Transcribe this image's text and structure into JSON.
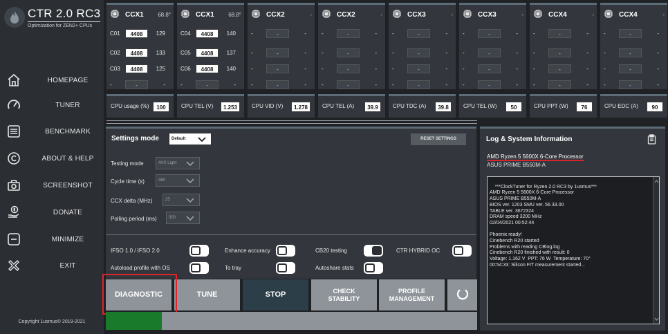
{
  "app": {
    "title": "CTR 2.0 RC3",
    "subtitle": "Optimization for ZEN2+ CPUs",
    "copyright": "Copyright 1usmus© 2019-2021"
  },
  "nav": [
    {
      "label": "HOMEPAGE",
      "icon": "home-icon"
    },
    {
      "label": "TUNER",
      "icon": "gauge-icon"
    },
    {
      "label": "BENCHMARK",
      "icon": "list-icon"
    },
    {
      "label": "ABOUT & HELP",
      "icon": "copyright-icon"
    },
    {
      "label": "SCREENSHOT",
      "icon": "camera-icon"
    },
    {
      "label": "DONATE",
      "icon": "donate-icon"
    },
    {
      "label": "MINIMIZE",
      "icon": "minimize-icon"
    },
    {
      "label": "EXIT",
      "icon": "exit-icon"
    }
  ],
  "ccx": [
    {
      "name": "CCX1",
      "temp": "68.8°",
      "cores": [
        {
          "id": "C01",
          "freq": "4408",
          "val": "129"
        },
        {
          "id": "C02",
          "freq": "4408",
          "val": "133"
        },
        {
          "id": "C03",
          "freq": "4408",
          "val": "125"
        },
        {
          "id": "-",
          "freq": "-",
          "val": "-"
        }
      ]
    },
    {
      "name": "CCX1",
      "temp": "68.8°",
      "cores": [
        {
          "id": "C04",
          "freq": "4408",
          "val": "140"
        },
        {
          "id": "C05",
          "freq": "4408",
          "val": "137"
        },
        {
          "id": "C06",
          "freq": "4408",
          "val": "140"
        },
        {
          "id": "-",
          "freq": "-",
          "val": "-"
        }
      ]
    },
    {
      "name": "CCX2",
      "temp": "-",
      "cores": [
        {
          "id": "-",
          "freq": "-",
          "val": "-"
        },
        {
          "id": "-",
          "freq": "-",
          "val": "-"
        },
        {
          "id": "-",
          "freq": "-",
          "val": "-"
        },
        {
          "id": "-",
          "freq": "-",
          "val": "-"
        }
      ]
    },
    {
      "name": "CCX2",
      "temp": "-",
      "cores": [
        {
          "id": "-",
          "freq": "-",
          "val": "-"
        },
        {
          "id": "-",
          "freq": "-",
          "val": "-"
        },
        {
          "id": "-",
          "freq": "-",
          "val": "-"
        },
        {
          "id": "-",
          "freq": "-",
          "val": "-"
        }
      ]
    },
    {
      "name": "CCX3",
      "temp": "-",
      "cores": [
        {
          "id": "-",
          "freq": "-",
          "val": "-"
        },
        {
          "id": "-",
          "freq": "-",
          "val": "-"
        },
        {
          "id": "-",
          "freq": "-",
          "val": "-"
        },
        {
          "id": "-",
          "freq": "-",
          "val": "-"
        }
      ]
    },
    {
      "name": "CCX3",
      "temp": "-",
      "cores": [
        {
          "id": "-",
          "freq": "-",
          "val": "-"
        },
        {
          "id": "-",
          "freq": "-",
          "val": "-"
        },
        {
          "id": "-",
          "freq": "-",
          "val": "-"
        },
        {
          "id": "-",
          "freq": "-",
          "val": "-"
        }
      ]
    },
    {
      "name": "CCX4",
      "temp": "-",
      "cores": [
        {
          "id": "-",
          "freq": "-",
          "val": "-"
        },
        {
          "id": "-",
          "freq": "-",
          "val": "-"
        },
        {
          "id": "-",
          "freq": "-",
          "val": "-"
        },
        {
          "id": "-",
          "freq": "-",
          "val": "-"
        }
      ]
    },
    {
      "name": "CCX4",
      "temp": "-",
      "cores": [
        {
          "id": "-",
          "freq": "-",
          "val": "-"
        },
        {
          "id": "-",
          "freq": "-",
          "val": "-"
        },
        {
          "id": "-",
          "freq": "-",
          "val": "-"
        },
        {
          "id": "-",
          "freq": "-",
          "val": "-"
        }
      ]
    }
  ],
  "stats": [
    {
      "label": "CPU usage (%)",
      "value": "100"
    },
    {
      "label": "CPU TEL (V)",
      "value": "1.253"
    },
    {
      "label": "CPU VID (V)",
      "value": "1.278"
    },
    {
      "label": "CPU TEL (A)",
      "value": "39.9"
    },
    {
      "label": "CPU TDC (A)",
      "value": "39.8"
    },
    {
      "label": "CPU TEL (W)",
      "value": "50"
    },
    {
      "label": "CPU PPT (W)",
      "value": "76"
    },
    {
      "label": "CPU EDC (A)",
      "value": "90"
    }
  ],
  "settings": {
    "title": "Settings mode",
    "mode_value": "Default",
    "reset_label": "RESET SETTINGS",
    "testing_mode": {
      "label": "Testing mode",
      "value": "AVX Light"
    },
    "cycle_time": {
      "label": "Cycle time (s)",
      "value": "360"
    },
    "ccx_delta": {
      "label": "CCX delta (MHz)",
      "value": "25"
    },
    "polling": {
      "label": "Polling period (ms)",
      "value": "500"
    },
    "toggles": [
      {
        "label": "IFSO 1.0 / IFSO 2.0",
        "on": false
      },
      {
        "label": "Enhance accuracy",
        "on": false
      },
      {
        "label": "CB20 testing",
        "on": true
      },
      {
        "label": "CTR HYBRID OC",
        "on": false
      },
      {
        "label": "Autoload profile with OS",
        "on": false
      },
      {
        "label": "To tray",
        "on": false
      },
      {
        "label": "Autoshare stats",
        "on": false
      }
    ]
  },
  "actions": {
    "diagnostic": "DIAGNOSTIC",
    "tune": "TUNE",
    "stop": "STOP",
    "check_stability_1": "CHECK",
    "check_stability_2": "STABILITY",
    "profile_1": "PROFILE",
    "profile_2": "MANAGEMENT"
  },
  "progress": 0.15,
  "log": {
    "title": "Log & System Information",
    "cpu": "AMD Ryzen 5 5600X 6-Core Processor",
    "board": "ASUS PRIME B550M-A",
    "text": "***ClockTuner for Ryzen 2.0 RC3 by 1usmus***\nAMD Ryzen 5 5600X 6-Core Processor\nASUS PRIME B550M-A\nBIOS ver. 1203 SMU ver. 56.33.00\nTABLE ver. 3672324\nDRAM speed 3200 MHz\n02/04/2021 00:52:44\n\nPhoenix ready!\nCinebench R20 started\nProblems with reading CBlog.log\nCinebench R20 finished with result: 0\nVoltage: 1.162 V  PPT: 76 W  Temperature: 70°\n00:54:33: Silicon FIT measurement started..."
  },
  "colors": {
    "accent_red": "#e0222b",
    "progress_green": "#1a7a2b",
    "panel": "#33373d"
  }
}
